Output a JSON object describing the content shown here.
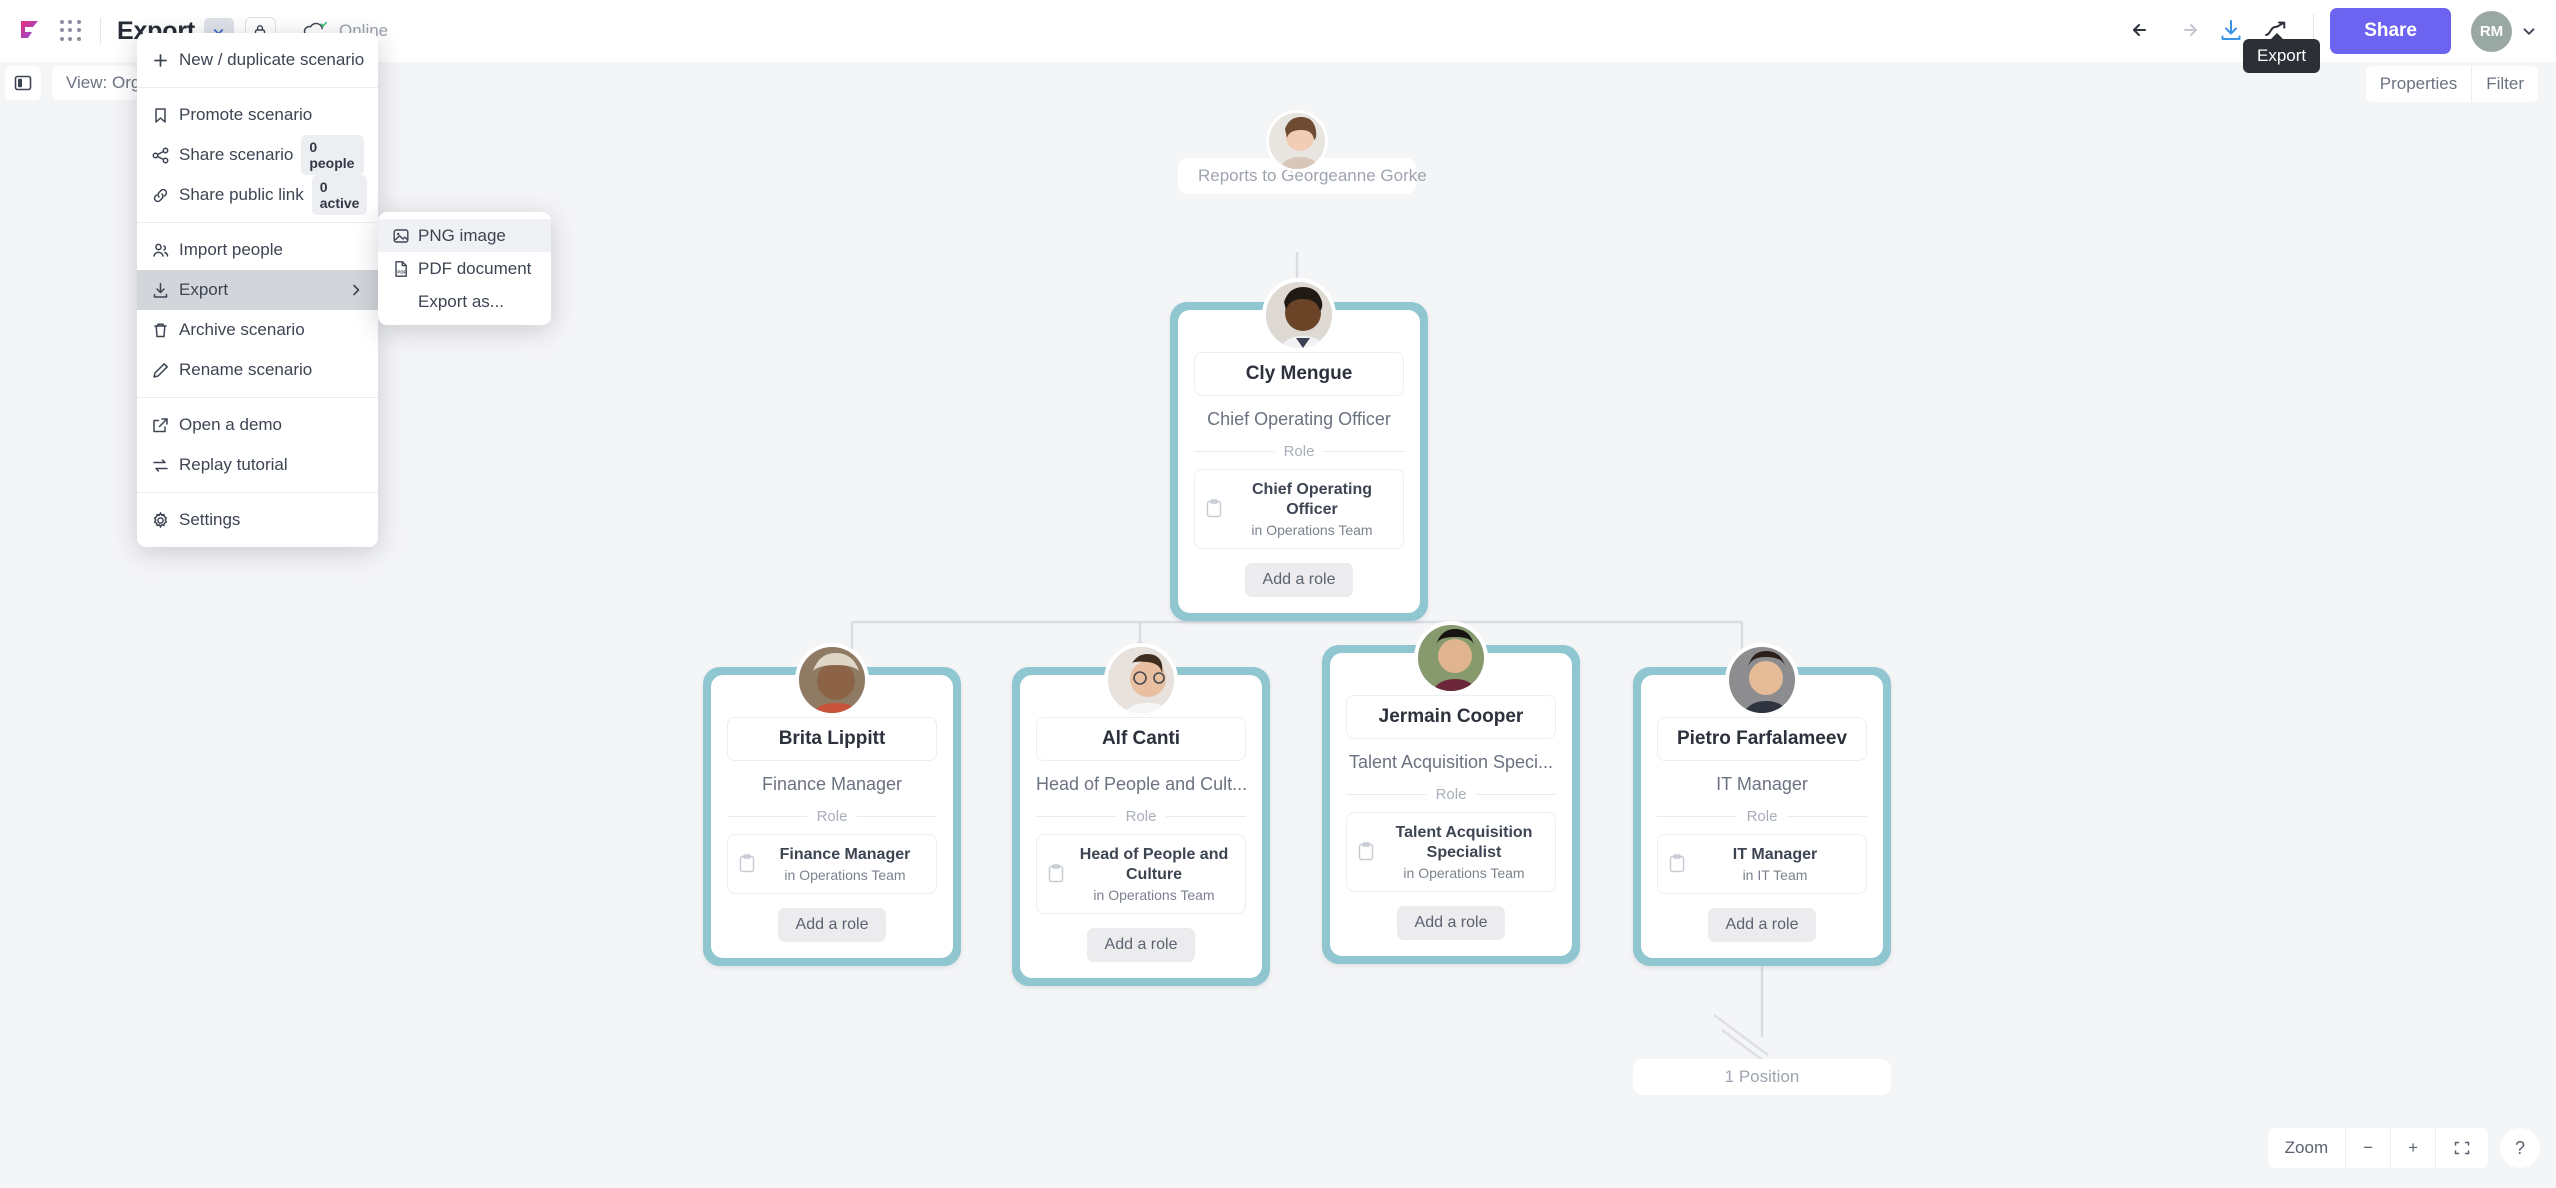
{
  "topbar": {
    "doc_title": "Export",
    "status_label": "Online",
    "share_label": "Share",
    "avatar_initials": "RM",
    "export_tooltip": "Export",
    "icons": {
      "logo": "flowchart-logo",
      "apps": "apps-grid-icon",
      "caret": "chevron-down-icon",
      "lock": "lock-icon",
      "cloud": "cloud-online-icon",
      "undo": "undo-icon",
      "redo": "redo-icon",
      "export": "export-download-icon",
      "insights": "trending-up-icon",
      "avatar_caret": "chevron-down-icon"
    }
  },
  "subbar": {
    "panel_toggle": "side-panel-toggle",
    "view_label": "View: Org c",
    "properties_label": "Properties",
    "filter_label": "Filter"
  },
  "menu": {
    "groups": [
      {
        "items": [
          {
            "icon": "plus-icon",
            "label": "New / duplicate scenario"
          }
        ]
      },
      {
        "items": [
          {
            "icon": "bookmark-icon",
            "label": "Promote scenario"
          },
          {
            "icon": "share-nodes-icon",
            "label": "Share scenario",
            "badge": "0 people"
          },
          {
            "icon": "link-icon",
            "label": "Share public link",
            "badge": "0 active"
          }
        ]
      },
      {
        "items": [
          {
            "icon": "users-icon",
            "label": "Import people"
          },
          {
            "icon": "export-download-icon",
            "label": "Export",
            "submenu": true,
            "active": true
          },
          {
            "icon": "trash-icon",
            "label": "Archive scenario"
          },
          {
            "icon": "pencil-icon",
            "label": "Rename scenario"
          }
        ]
      },
      {
        "items": [
          {
            "icon": "external-link-icon",
            "label": "Open a demo"
          },
          {
            "icon": "replay-icon",
            "label": "Replay tutorial"
          }
        ]
      },
      {
        "items": [
          {
            "icon": "gear-icon",
            "label": "Settings"
          }
        ]
      }
    ]
  },
  "submenu": {
    "items": [
      {
        "icon": "image-icon",
        "label": "PNG image",
        "highlighted": true
      },
      {
        "icon": "pdf-file-icon",
        "label": "PDF document"
      },
      {
        "icon": "",
        "label": "Export as..."
      }
    ]
  },
  "chart": {
    "reports_to": "Reports to Georgeanne Gorke",
    "position_stack": "1 Position",
    "role_divider_label": "Role",
    "add_role_label": "Add a role",
    "accent_color": "#8fc6cf",
    "nodes": [
      {
        "name": "Cly Mengue",
        "title": "Chief Operating Officer",
        "role_name": "Chief Operating Officer",
        "role_team": "in Operations Team"
      },
      {
        "name": "Brita Lippitt",
        "title": "Finance Manager",
        "role_name": "Finance Manager",
        "role_team": "in Operations Team"
      },
      {
        "name": "Alf Canti",
        "title": "Head of People and Cult...",
        "role_name": "Head of People and Culture",
        "role_team": "in Operations Team"
      },
      {
        "name": "Jermain Cooper",
        "title": "Talent Acquisition Speci...",
        "role_name": "Talent Acquisition Specialist",
        "role_team": "in Operations Team"
      },
      {
        "name": "Pietro Farfalameev",
        "title": "IT Manager",
        "role_name": "IT Manager",
        "role_team": "in IT Team"
      }
    ]
  },
  "zoombar": {
    "label": "Zoom",
    "minus": "−",
    "plus": "+",
    "fit": "fit-screen-icon",
    "help": "?"
  }
}
